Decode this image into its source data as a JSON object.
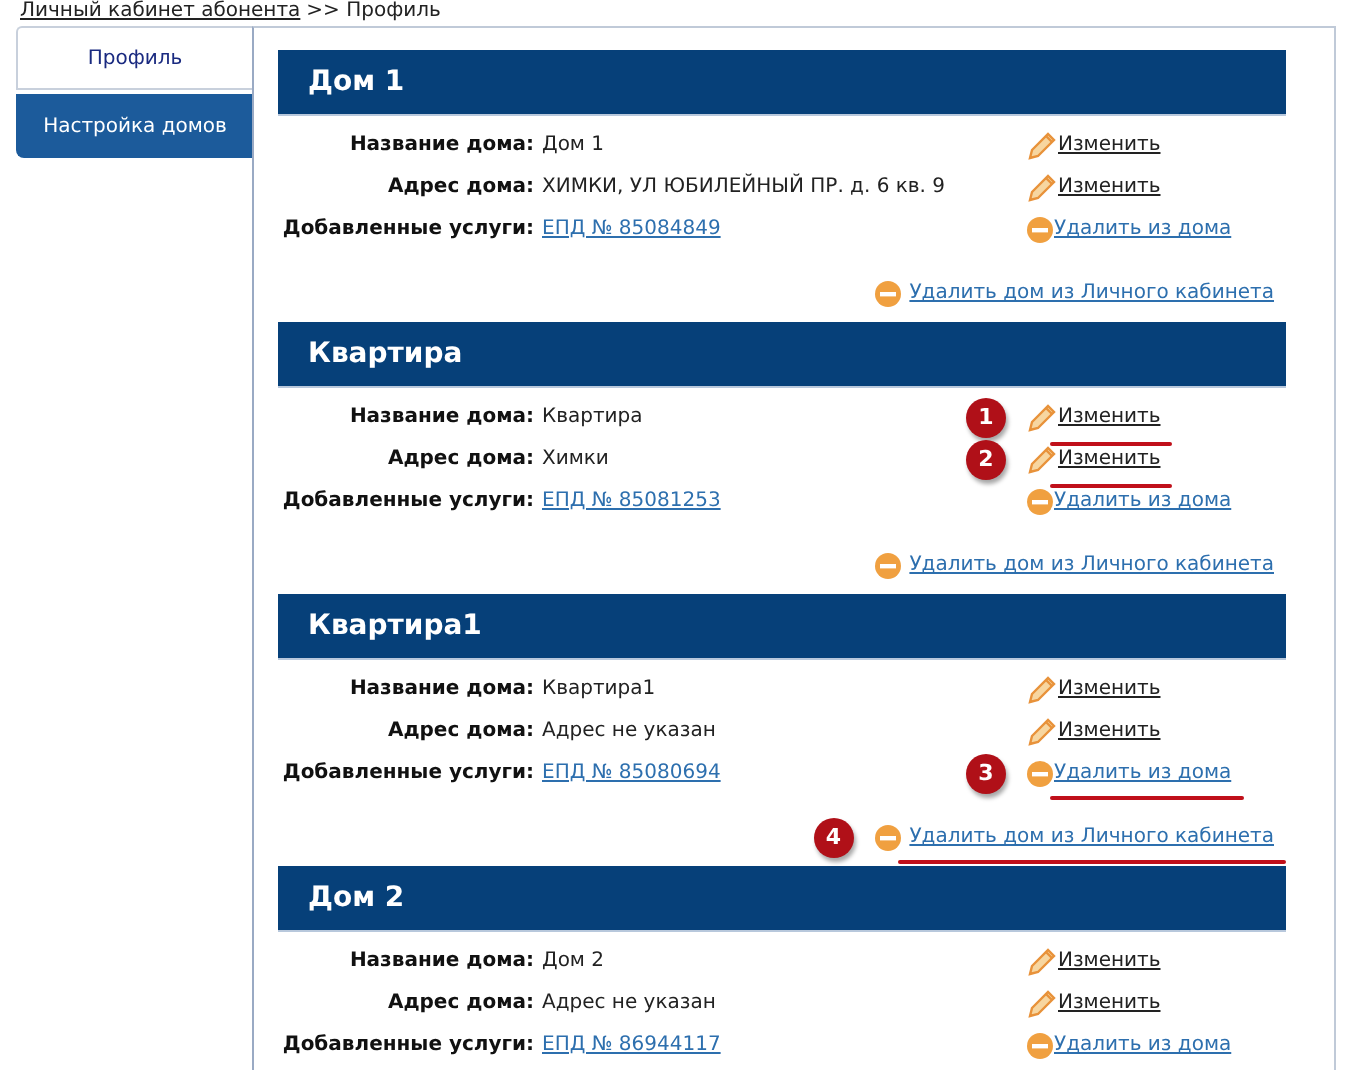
{
  "breadcrumb": {
    "link": "Личный кабинет абонента",
    "rest": ">> Профиль"
  },
  "tabs": [
    {
      "label": "Профиль",
      "selected": true
    },
    {
      "label": "Настройка домов",
      "selected": false
    }
  ],
  "houses": [
    {
      "title": "Дом 1",
      "rows": [
        {
          "label": "Название дома:",
          "value": "Дом 1",
          "kind": "text",
          "action": {
            "kind": "edit",
            "label": "Изменить"
          }
        },
        {
          "label": "Адрес дома:",
          "value": "ХИМКИ, УЛ ЮБИЛЕЙНЫЙ ПР. д. 6 кв. 9",
          "kind": "text",
          "action": {
            "kind": "edit",
            "label": "Изменить"
          }
        },
        {
          "label": "Добавленные услуги:",
          "value": "ЕПД № 85084849",
          "kind": "link",
          "action": {
            "kind": "remove",
            "label": "Удалить из дома"
          }
        }
      ],
      "remove": {
        "label": "Удалить дом из Личного кабинета"
      }
    },
    {
      "title": "Квартира",
      "rows": [
        {
          "label": "Название дома:",
          "value": "Квартира",
          "kind": "text",
          "action": {
            "kind": "edit",
            "label": "Изменить",
            "marker": "1"
          }
        },
        {
          "label": "Адрес дома:",
          "value": "Химки",
          "kind": "text",
          "action": {
            "kind": "edit",
            "label": "Изменить",
            "marker": "2"
          }
        },
        {
          "label": "Добавленные услуги:",
          "value": "ЕПД № 85081253",
          "kind": "link",
          "action": {
            "kind": "remove",
            "label": "Удалить из дома"
          }
        }
      ],
      "remove": {
        "label": "Удалить дом из Личного кабинета"
      }
    },
    {
      "title": "Квартира1",
      "rows": [
        {
          "label": "Название дома:",
          "value": "Квартира1",
          "kind": "text",
          "action": {
            "kind": "edit",
            "label": "Изменить"
          }
        },
        {
          "label": "Адрес дома:",
          "value": "Адрес не указан",
          "kind": "text",
          "action": {
            "kind": "edit",
            "label": "Изменить"
          }
        },
        {
          "label": "Добавленные услуги:",
          "value": "ЕПД № 85080694",
          "kind": "link",
          "action": {
            "kind": "remove",
            "label": "Удалить из дома",
            "marker": "3"
          }
        }
      ],
      "remove": {
        "label": "Удалить дом из Личного кабинета",
        "marker": "4"
      }
    },
    {
      "title": "Дом 2",
      "rows": [
        {
          "label": "Название дома:",
          "value": "Дом 2",
          "kind": "text",
          "action": {
            "kind": "edit",
            "label": "Изменить"
          }
        },
        {
          "label": "Адрес дома:",
          "value": "Адрес не указан",
          "kind": "text",
          "action": {
            "kind": "edit",
            "label": "Изменить"
          }
        },
        {
          "label": "Добавленные услуги:",
          "value": "ЕПД № 86944117",
          "kind": "link",
          "action": {
            "kind": "remove",
            "label": "Удалить из дома"
          }
        }
      ]
    }
  ]
}
